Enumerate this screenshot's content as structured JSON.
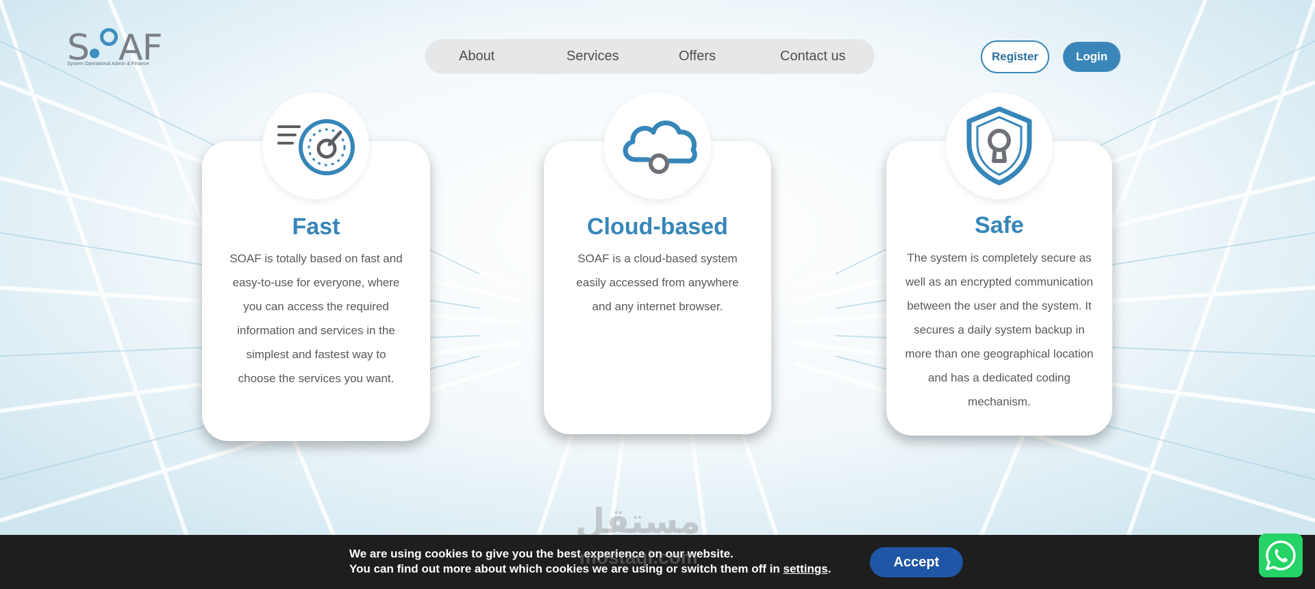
{
  "brand": {
    "name": "S.OAF",
    "tagline": "System Operational Admin     & Finance"
  },
  "nav": {
    "items": [
      "About",
      "Services",
      "Offers",
      "Contact us"
    ]
  },
  "auth": {
    "register": "Register",
    "login": "Login"
  },
  "cards": [
    {
      "title": "Fast",
      "icon": "speedometer-icon",
      "text": "SOAF is totally based on fast and easy-to-use for everyone, where you can access the required information and services in the simplest and fastest way to choose the services you want."
    },
    {
      "title": "Cloud-based",
      "icon": "cloud-icon",
      "text": "SOAF is a cloud-based system easily accessed from anywhere and any internet browser."
    },
    {
      "title": "Safe",
      "icon": "shield-lock-icon",
      "text": "The system is completely secure as well as an encrypted communication between the user and the system. It secures a daily system backup in more than one geographical location and has a dedicated coding mechanism."
    }
  ],
  "cookie": {
    "line1": "We are using cookies to give you the best experience on our website.",
    "line2_prefix": "You can find out more about which cookies we are using or switch them off in",
    "link": "settings",
    "line2_suffix": ".",
    "accept": "Accept"
  },
  "watermark": {
    "text": "مستقل",
    "sub": "mostaql.com"
  },
  "colors": {
    "accent": "#3686b9",
    "accept": "#1f56a6",
    "cookie_bg": "#1e1e1e",
    "whatsapp": "#25d366"
  }
}
